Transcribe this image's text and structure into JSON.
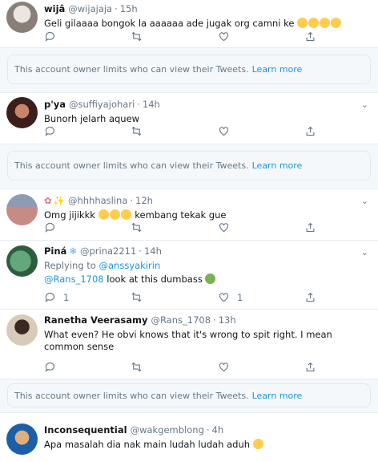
{
  "tweets": [
    {
      "name": "wijâ",
      "handle": "@wijajaja",
      "time": "15h",
      "text": "Geli gilaaaa bongok la aaaaaa ade jugak org camni ke",
      "emojis": [
        "sob",
        "sob",
        "sob",
        "sob"
      ],
      "avatar_colors": [
        "#d9d3cf",
        "#8a7f78"
      ]
    },
    {
      "name": "p'ya",
      "handle": "@suffiyajohari",
      "time": "14h",
      "text": "Bunorh jelarh aquew",
      "avatar_colors": [
        "#3a1f1c",
        "#c9846b"
      ]
    },
    {
      "name": "",
      "handle": "@hhhhaslina",
      "time": "12h",
      "name_icons": [
        "flower-icon",
        "sparkles-icon"
      ],
      "text_after_emojis": "kembang tekak gue",
      "text": "Omg jijikkk",
      "emojis": [
        "sob",
        "sob",
        "weary"
      ],
      "avatar_colors": [
        "#c88b84",
        "#8d9bb5"
      ]
    },
    {
      "name": "Piná",
      "handle": "@prina2211",
      "time": "14h",
      "name_icons": [
        "snowflake-icon"
      ],
      "reply_label": "Replying to",
      "reply_handle": "@anssyakirin",
      "mention": "@Rans_1708",
      "text": "look at this dumbass",
      "emojis": [
        "nauseated"
      ],
      "reply_count": "1",
      "like_count": "1",
      "avatar_colors": [
        "#63a77a",
        "#2e5d3e"
      ]
    },
    {
      "name": "Ranetha Veerasamy",
      "handle": "@Rans_1708",
      "time": "13h",
      "text": "What even? He obvi knows that it's wrong to spit right. I mean common sense",
      "avatar_colors": [
        "#3b2a22",
        "#d8cbb9"
      ]
    },
    {
      "name": "Inconsequential",
      "handle": "@wakgemblong",
      "time": "4h",
      "text": "Apa masalah dia nak main ludah ludah aduh",
      "emojis": [
        "confounded"
      ],
      "avatar_colors": [
        "#1b5fa8",
        "#e0b07a"
      ]
    }
  ],
  "notice": {
    "text": "This account owner limits who can view their Tweets.",
    "link": "Learn more"
  },
  "colors": {
    "accent": "#1b95e0",
    "muted": "#657786",
    "text": "#14171a",
    "border": "#e6ecf0",
    "notice_bg": "#f5f8fa"
  }
}
